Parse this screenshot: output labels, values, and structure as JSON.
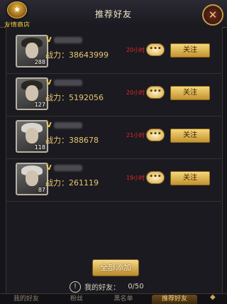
{
  "window": {
    "title": "推荐好友"
  },
  "shop": {
    "label": "友情商店",
    "badge": "★"
  },
  "close_icon": "close-icon",
  "recommended": [
    {
      "power_label": "战力：38643999",
      "level": "288",
      "time": "20小时",
      "follow_label": "关注",
      "vip": "V",
      "hair": "dark"
    },
    {
      "power_label": "战力：5192056",
      "level": "127",
      "time": "20小时",
      "follow_label": "关注",
      "vip": "V",
      "hair": "dark"
    },
    {
      "power_label": "战力：388678",
      "level": "118",
      "time": "21小时",
      "follow_label": "关注",
      "vip": "V",
      "hair": "light"
    },
    {
      "power_label": "战力：261119",
      "level": "87",
      "time": "19小时",
      "follow_label": "关注",
      "vip": "V",
      "hair": "light"
    }
  ],
  "chat_bubble_text": "•••",
  "add_all_label": "全部添加",
  "friends": {
    "label": "我的好友：",
    "count": "0/50",
    "icon": "!"
  },
  "tabs": [
    {
      "label": "我的好友",
      "active": false
    },
    {
      "label": "粉丝",
      "active": false
    },
    {
      "label": "黑名单",
      "active": false
    },
    {
      "label": "推荐好友",
      "active": true
    }
  ],
  "colors": {
    "accent": "#f1c84b",
    "time_red": "#e02a2a",
    "panel_bg": "#1b1a20"
  }
}
